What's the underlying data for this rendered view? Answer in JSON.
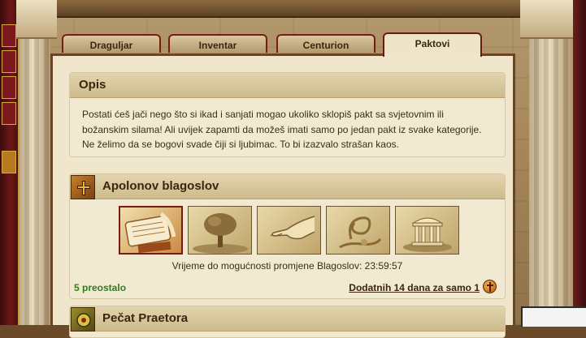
{
  "tabs": [
    {
      "label": "Draguljar"
    },
    {
      "label": "Inventar"
    },
    {
      "label": "Centurion"
    },
    {
      "label": "Paktovi"
    }
  ],
  "active_tab": "Paktovi",
  "description": {
    "heading": "Opis",
    "text": "Postati ćeš jači nego što si ikad i sanjati mogao ukoliko sklopiš pakt sa svjetovnim ili božanskim silama! Ali uvijek zapamti da možeš imati samo po jedan pakt iz svake kategorije. Ne želimo da se bogovi svade čiji si ljubimac. To bi izazvalo strašan kaos."
  },
  "apollo": {
    "title": "Apolonov blagoslov",
    "emblem_icon": "cross-icon",
    "pacts": [
      {
        "icon": "scroll-icon",
        "selected": true
      },
      {
        "icon": "tree-icon",
        "selected": false
      },
      {
        "icon": "hand-icon",
        "selected": false
      },
      {
        "icon": "ribbon-icon",
        "selected": false
      },
      {
        "icon": "temple-icon",
        "selected": false
      }
    ],
    "timer_text": "Vrijeme do mogućnosti promjene Blagoslov: 23:59:57",
    "remaining_text": "5 preostalo",
    "extend_text": "Dodatnih 14 dana za samo 1"
  },
  "praetor": {
    "title": "Pečat Praetora",
    "emblem_icon": "seal-icon"
  },
  "colors": {
    "accent_red": "#7a1c14",
    "remaining_green": "#2f7d1d",
    "panel_bg": "#efe6cb"
  }
}
